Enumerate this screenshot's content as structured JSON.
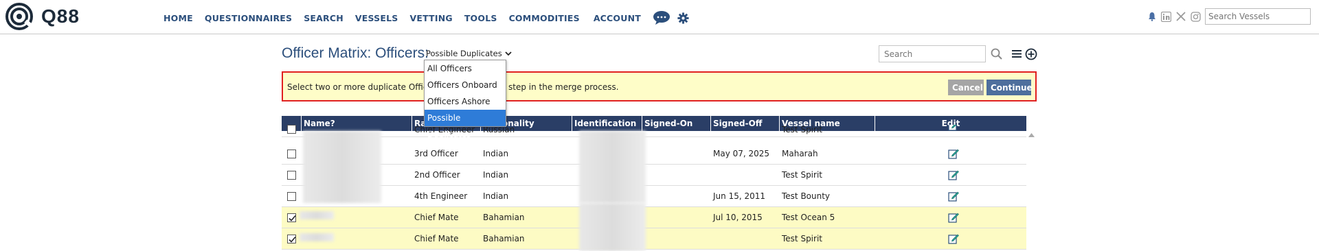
{
  "brand": {
    "name": "Q88"
  },
  "nav": {
    "items": [
      "HOME",
      "QUESTIONNAIRES",
      "SEARCH",
      "VESSELS",
      "VETTING",
      "TOOLS",
      "COMMODITIES",
      "ACCOUNT"
    ],
    "search_placeholder": "Search Vessels"
  },
  "page": {
    "title": "Officer Matrix: Officers:",
    "filter_value": "Possible Duplicates",
    "filter_options": [
      "All Officers",
      "Officers Onboard",
      "Officers Ashore",
      "Possible Duplicates"
    ],
    "search_placeholder": "Search"
  },
  "banner": {
    "text_left": "Select two or more duplicate Officers",
    "text_right": "step in the merge process.",
    "cancel_label": "Cancel",
    "continue_label": "Continue"
  },
  "table": {
    "columns": [
      "Name",
      "Rank",
      "Nationality",
      "Identification #",
      "Signed-On",
      "Signed-Off",
      "Vessel name",
      "Edit"
    ],
    "rows": [
      {
        "checked": false,
        "rank": "Chief Engineer",
        "nationality": "Russian",
        "signed_on": "",
        "signed_off": "",
        "vessel": "Test Spirit",
        "highlight": false
      },
      {
        "checked": false,
        "rank": "3rd Officer",
        "nationality": "Indian",
        "signed_on": "",
        "signed_off": "May 07, 2025",
        "vessel": "Maharah",
        "highlight": false
      },
      {
        "checked": false,
        "rank": "2nd Officer",
        "nationality": "Indian",
        "signed_on": "",
        "signed_off": "",
        "vessel": "Test Spirit",
        "highlight": false
      },
      {
        "checked": false,
        "rank": "4th Engineer",
        "nationality": "Indian",
        "signed_on": "",
        "signed_off": "Jun 15, 2011",
        "vessel": "Test Bounty",
        "highlight": false
      },
      {
        "checked": true,
        "rank": "Chief Mate",
        "nationality": "Bahamian",
        "signed_on": "",
        "signed_off": "Jul 10, 2015",
        "vessel": "Test Ocean 5",
        "highlight": true
      },
      {
        "checked": true,
        "rank": "Chief Mate",
        "nationality": "Bahamian",
        "signed_on": "",
        "signed_off": "",
        "vessel": "Test Spirit",
        "highlight": true
      }
    ]
  },
  "colors": {
    "nav": "#2c4f7c",
    "header_bg": "#2a3e66",
    "highlight": "#fdfbc4",
    "banner_border": "#e02020"
  }
}
